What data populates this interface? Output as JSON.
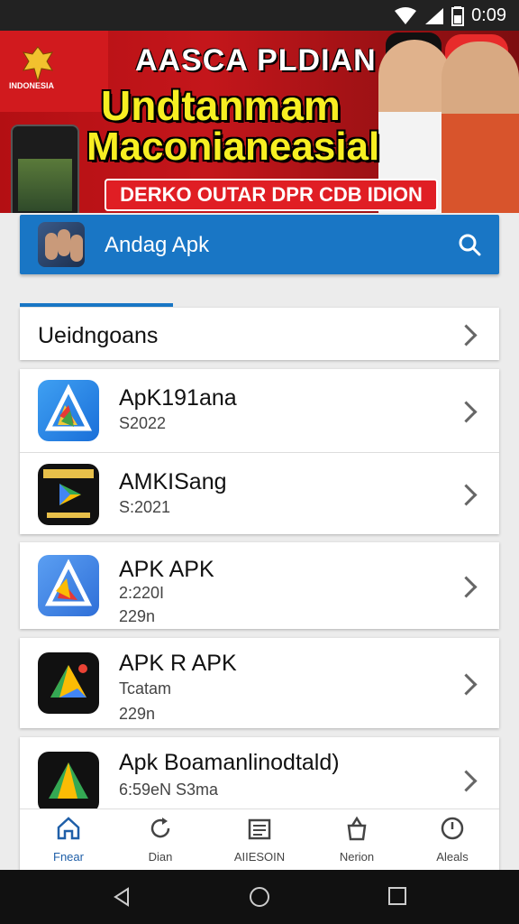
{
  "status_bar": {
    "time": "0:09"
  },
  "banner": {
    "emblem_text": "INDONESIA",
    "headline_1": "AASCA PLDIAN",
    "headline_2": "Undtanmam",
    "headline_3": "Maconianeasial",
    "ribbon": "DERKO OUTAR DPR CDB IDION"
  },
  "header": {
    "title": "Andag Apk"
  },
  "section": {
    "label": "Ueidngoans"
  },
  "apps": [
    {
      "name": "ApK191ana",
      "line1": "S2022",
      "line2": ""
    },
    {
      "name": "AMKISang",
      "line1": "S:2021",
      "line2": ""
    },
    {
      "name": "APK APK",
      "line1": "2:220I",
      "line2": "229n"
    },
    {
      "name": "APK R APK",
      "line1": "Tcatam",
      "line2": "229n"
    },
    {
      "name": "Apk Boamanlinodtald)",
      "line1": "6:59eN S3ma",
      "line2": ""
    }
  ],
  "bottom_nav": [
    {
      "label": "Fnear",
      "icon": "home-icon"
    },
    {
      "label": "Dian",
      "icon": "refresh-icon"
    },
    {
      "label": "AIIESOIN",
      "icon": "list-icon"
    },
    {
      "label": "Nerion",
      "icon": "bag-icon"
    },
    {
      "label": "Aleals",
      "icon": "clock-icon"
    }
  ],
  "colors": {
    "accent": "#1976c5",
    "banner_red": "#c4161b",
    "banner_yellow": "#f7ef22"
  }
}
